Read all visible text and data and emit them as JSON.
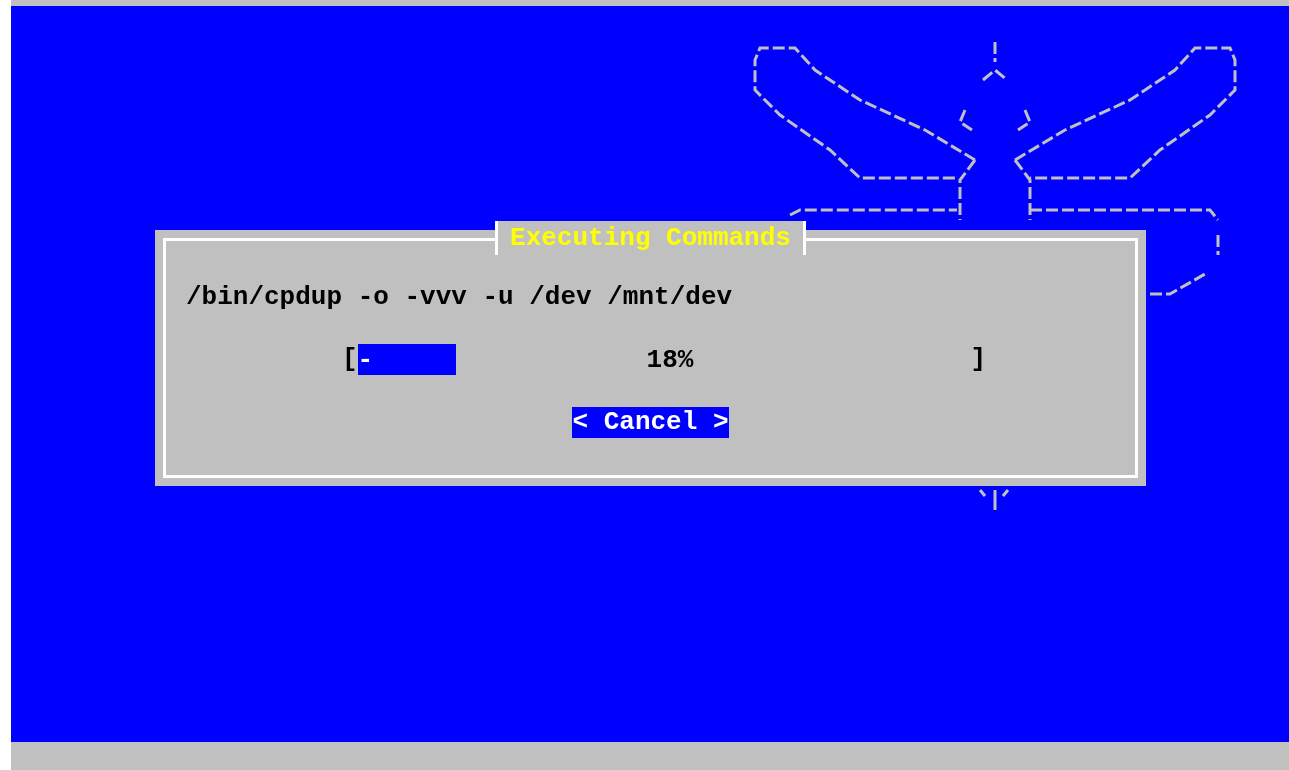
{
  "dialog": {
    "title": "Executing Commands",
    "command": "/bin/cpdup -o -vvv -u /dev /mnt/dev",
    "progress": {
      "open_bracket": "[",
      "spinner": "-",
      "level": 0.16,
      "reading": "18%",
      "close_bracket": "]"
    },
    "buttons": [
      {
        "label": "< Cancel >",
        "selected": true
      }
    ]
  }
}
